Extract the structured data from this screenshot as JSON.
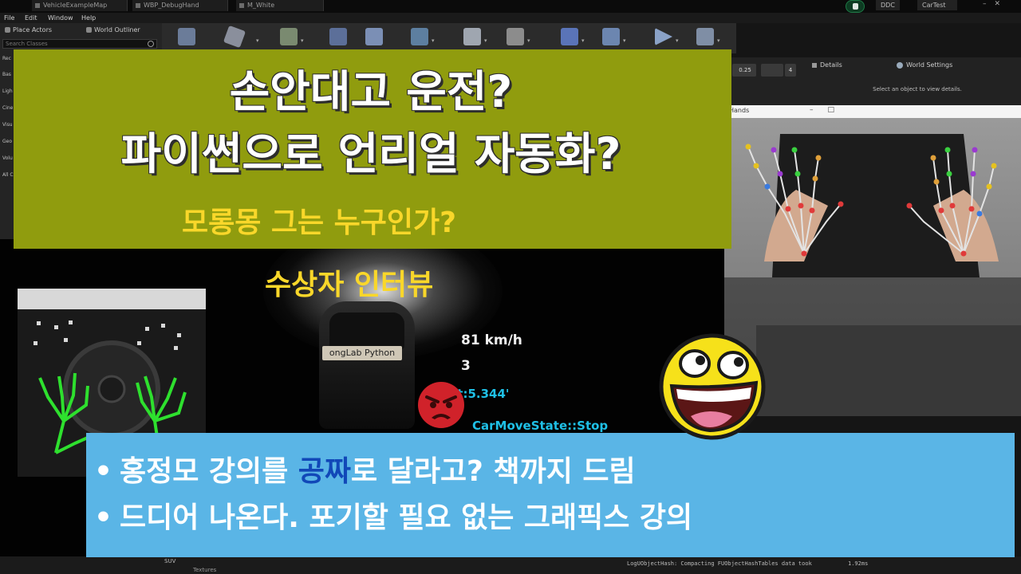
{
  "editor": {
    "tabs": [
      "VehicleExampleMap",
      "WBP_DebugHand",
      "M_White"
    ],
    "menu": [
      "File",
      "Edit",
      "Window",
      "Help"
    ],
    "ddc_label": "DDC",
    "project_name": "CarTest",
    "left_tabs": [
      "Place Actors",
      "World Outliner"
    ],
    "search_placeholder": "Search Classes",
    "categories": [
      "Rec",
      "Bas",
      "Ligh",
      "Cine",
      "Visu",
      "Geo",
      "Volu",
      "All C"
    ],
    "details_tab": "Details",
    "world_settings_tab": "World Settings",
    "details_hint": "Select an object to view details.",
    "viewport_snap": "0.25",
    "viewport_cam": "4",
    "hands_window_title": "Hands",
    "content_folder": "SUV",
    "content_folder2": "Textures",
    "log_line": "LogUObjectHash: Compacting FUObjectHashTables data took",
    "log_time": "1.92ms"
  },
  "hud": {
    "speed": "81 km/h",
    "gear": "3",
    "time": "ot:5.344'",
    "state": "CarMoveState::Stop",
    "plate": "ongLab Python"
  },
  "thumbnail": {
    "title_line1": "손안대고 운전?",
    "title_line2": "파이썬으로 언리얼 자동화?",
    "sub_line1": "모롱몽 그는 누구인가?",
    "sub_line2": "수상자 인터뷰",
    "bullet1_pre": "홍정모 강의를 ",
    "bullet1_highlight": "공짜",
    "bullet1_post": "로 달라고? 책까지 드림",
    "bullet2": "드디어 나온다. 포기할 필요 없는 그래픽스 강의",
    "bullet_symbol": "•"
  },
  "colors": {
    "title_box": "#909c0e",
    "subtitle": "#f9d72a",
    "bullet_box": "#5ab5e6",
    "highlight": "#1148b8",
    "hud_cyan": "#1fc0e6"
  },
  "icons": [
    "angry-face-emoji",
    "grinning-face-emoji",
    "unreal-logo"
  ]
}
